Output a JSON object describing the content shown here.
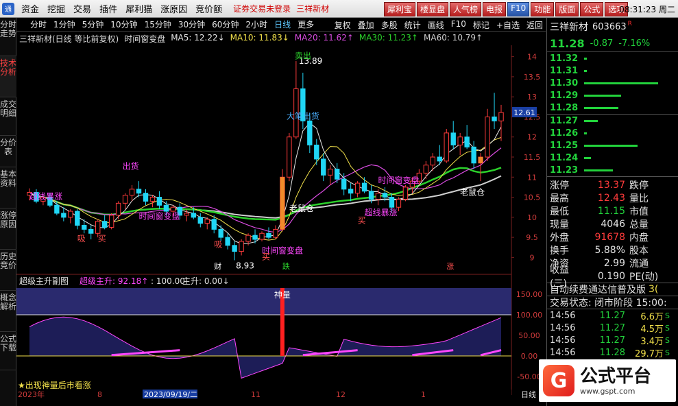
{
  "menubar": {
    "items": [
      "资金",
      "挖掘",
      "交易",
      "插件",
      "犀利猫",
      "涨原因",
      "竞价额"
    ],
    "notice": "证券交易未登录",
    "notice_stock": "三祥新材",
    "tool_buttons": [
      "犀利宝",
      "楼显盘",
      "人气榜",
      "电报",
      "F10",
      "功能",
      "版面",
      "公式",
      "选项"
    ],
    "clock": "08:31:23 周二"
  },
  "left_tabs": [
    "分时走势",
    "技术分析",
    "成交明细",
    "分价表",
    "基本资料",
    "涨停原因",
    "历史竞价",
    "概念解析",
    "公式下载"
  ],
  "active_left_tab": 1,
  "periods": [
    "分时",
    "1分钟",
    "5分钟",
    "10分钟",
    "15分钟",
    "30分钟",
    "60分钟",
    "2小时",
    "日线"
  ],
  "active_period": 8,
  "more_label": "更多",
  "right_tools": [
    "复权",
    "叠加",
    "多股",
    "统计",
    "画线",
    "F10",
    "标记",
    "+自选",
    "返回"
  ],
  "chart_header": {
    "title": "三祥新材(日线 等比前复权)",
    "indicator": "时间窗变盘",
    "ma5": "MA5: 12.22↓",
    "ma10": "MA10: 11.83↓",
    "ma20": "MA20: 11.62↑",
    "ma30": "MA30: 11.23↑",
    "ma60": "MA60: 10.79↑"
  },
  "colors": {
    "up": "#ff3b3b",
    "down": "#20d6f5",
    "ma5": "#e8e8e8",
    "ma10": "#f2e14b",
    "ma20": "#d94ce0",
    "ma30": "#2bd12b",
    "ma60": "#cfcfcf",
    "signal_magenta": "#ff47ff",
    "sub_area": "#2a2a6e"
  },
  "chart_data": {
    "type": "candlestick",
    "yaxis_ticks": [
      9.0,
      9.5,
      10.0,
      10.5,
      11.0,
      11.5,
      12.0,
      12.5,
      13.0,
      13.5,
      14.0
    ],
    "ylim": [
      8.75,
      14.25
    ],
    "current_price_marker": "12.61",
    "annotations": {
      "high_label": "13.89",
      "low_label": "8.93",
      "sell_signal_1": "出货",
      "sell_signal_2": "卖出",
      "big_sell": "大笔出货",
      "time_window": "时间窗变盘",
      "breakout": "超线暴涨",
      "rat_warehouse": "老鼠仓",
      "buy": "买",
      "buy_alt": "吸",
      "rise_mark": "涨",
      "fall_mark": "跌",
      "fin_mark": "财"
    },
    "candles": [
      [
        10.55,
        10.72,
        10.42,
        10.62
      ],
      [
        10.62,
        10.7,
        10.35,
        10.4
      ],
      [
        10.4,
        10.55,
        10.3,
        10.5
      ],
      [
        10.5,
        10.6,
        10.25,
        10.3
      ],
      [
        10.3,
        10.4,
        10.05,
        10.1
      ],
      [
        10.1,
        10.25,
        9.9,
        10.0
      ],
      [
        10.0,
        10.2,
        9.85,
        10.15
      ],
      [
        10.15,
        10.2,
        9.7,
        9.8
      ],
      [
        9.8,
        9.95,
        9.6,
        9.7
      ],
      [
        9.7,
        9.8,
        9.45,
        9.6
      ],
      [
        9.6,
        9.95,
        9.5,
        9.9
      ],
      [
        9.9,
        10.05,
        9.7,
        9.75
      ],
      [
        9.75,
        10.1,
        9.7,
        10.05
      ],
      [
        10.05,
        10.4,
        9.95,
        10.35
      ],
      [
        10.35,
        10.6,
        10.2,
        10.55
      ],
      [
        10.55,
        10.8,
        10.4,
        10.7
      ],
      [
        10.7,
        10.9,
        10.5,
        10.6
      ],
      [
        10.6,
        10.7,
        10.3,
        10.4
      ],
      [
        10.4,
        10.55,
        10.25,
        10.5
      ],
      [
        10.5,
        10.65,
        10.2,
        10.3
      ],
      [
        10.3,
        10.4,
        10.05,
        10.15
      ],
      [
        10.15,
        10.3,
        10.0,
        10.25
      ],
      [
        10.25,
        10.35,
        9.95,
        10.05
      ],
      [
        10.05,
        10.2,
        9.9,
        10.1
      ],
      [
        10.1,
        10.25,
        9.95,
        10.0
      ],
      [
        10.0,
        10.1,
        9.75,
        9.85
      ],
      [
        9.85,
        10.0,
        9.7,
        9.95
      ],
      [
        9.95,
        10.05,
        9.6,
        9.7
      ],
      [
        9.7,
        9.8,
        9.4,
        9.5
      ],
      [
        9.5,
        9.6,
        9.2,
        9.3
      ],
      [
        9.3,
        9.4,
        8.93,
        9.15
      ],
      [
        9.15,
        9.45,
        9.05,
        9.4
      ],
      [
        9.4,
        9.6,
        9.3,
        9.55
      ],
      [
        9.55,
        9.7,
        9.35,
        9.45
      ],
      [
        9.45,
        9.65,
        9.4,
        9.6
      ],
      [
        9.6,
        9.75,
        9.45,
        9.5
      ],
      [
        9.5,
        9.8,
        9.45,
        9.7
      ],
      [
        9.7,
        11.2,
        9.65,
        11.0
      ],
      [
        11.0,
        12.1,
        10.9,
        12.0
      ],
      [
        12.0,
        13.89,
        11.95,
        13.2
      ],
      [
        13.2,
        13.6,
        12.2,
        12.4
      ],
      [
        12.4,
        12.6,
        11.6,
        11.8
      ],
      [
        11.8,
        11.95,
        11.3,
        11.45
      ],
      [
        11.45,
        11.6,
        10.9,
        11.05
      ],
      [
        11.05,
        11.3,
        10.8,
        11.2
      ],
      [
        11.2,
        11.35,
        10.85,
        10.95
      ],
      [
        10.95,
        11.1,
        10.55,
        10.7
      ],
      [
        10.7,
        10.85,
        10.4,
        10.6
      ],
      [
        10.6,
        10.9,
        10.5,
        10.85
      ],
      [
        10.85,
        11.0,
        10.6,
        10.65
      ],
      [
        10.65,
        10.8,
        10.35,
        10.45
      ],
      [
        10.45,
        10.7,
        10.3,
        10.6
      ],
      [
        10.6,
        10.75,
        10.4,
        10.5
      ],
      [
        10.5,
        10.6,
        10.1,
        10.25
      ],
      [
        10.25,
        10.5,
        10.15,
        10.45
      ],
      [
        10.45,
        10.8,
        10.4,
        10.75
      ],
      [
        10.75,
        11.0,
        10.6,
        10.9
      ],
      [
        10.9,
        11.2,
        10.8,
        11.1
      ],
      [
        11.1,
        11.4,
        10.95,
        11.3
      ],
      [
        11.3,
        11.6,
        11.15,
        11.5
      ],
      [
        11.5,
        11.8,
        11.3,
        11.4
      ],
      [
        11.4,
        12.2,
        11.35,
        12.1
      ],
      [
        12.1,
        12.4,
        11.7,
        11.8
      ],
      [
        11.8,
        12.1,
        11.55,
        12.0
      ],
      [
        12.0,
        12.3,
        11.7,
        11.75
      ],
      [
        11.75,
        11.9,
        11.2,
        11.35
      ],
      [
        11.35,
        11.6,
        10.9,
        11.5
      ],
      [
        11.5,
        12.7,
        11.4,
        12.5
      ],
      [
        12.5,
        13.1,
        12.2,
        12.4
      ],
      [
        12.4,
        12.8,
        11.9,
        12.61
      ]
    ]
  },
  "sub_chart": {
    "title": "超级主升副图",
    "value1": "超级主升: 92.18↑",
    "value2": ": 100.00",
    "value3": "主升: 0.00↓",
    "yaxis_ticks": [
      "150.00",
      "100.00",
      "50.00",
      "0.00",
      "-50.00"
    ],
    "god_label": "神量",
    "footer_label": "★出现神量后市看涨",
    "dates": [
      "2023年",
      "8",
      "2023/09/19/二",
      "11",
      "12",
      "1"
    ],
    "right_label": "日线"
  },
  "right_panel": {
    "name": "三祥新材",
    "code": "603663",
    "code_flag": "R",
    "price": "11.28",
    "change": "-0.87",
    "change_pct": "-7.16%",
    "order_book_upper": [
      {
        "price": "11.32",
        "bar": 4
      },
      {
        "price": "11.31",
        "bar": 4
      },
      {
        "price": "11.30",
        "bar": 108
      },
      {
        "price": "11.29",
        "bar": 54
      },
      {
        "price": "11.28",
        "bar": 50
      }
    ],
    "order_book_lower": [
      {
        "price": "11.27",
        "bar": 20
      },
      {
        "price": "11.26",
        "bar": 4
      },
      {
        "price": "11.25",
        "bar": 78
      },
      {
        "price": "11.24",
        "bar": 10
      },
      {
        "price": "11.23",
        "bar": 42
      }
    ],
    "stats": [
      {
        "l1": "涨停",
        "v1": "13.37",
        "c1": "red",
        "l2": "跌停"
      },
      {
        "l1": "最高",
        "v1": "12.43",
        "c1": "red",
        "l2": "量比"
      },
      {
        "l1": "最低",
        "v1": "11.15",
        "c1": "green",
        "l2": "市值"
      },
      {
        "l1": "现量",
        "v1": "4046",
        "c1": "white",
        "l2": "总量"
      },
      {
        "l1": "外盘",
        "v1": "91678",
        "c1": "red",
        "l2": "内盘"
      },
      {
        "l1": "换手",
        "v1": "5.88%",
        "c1": "white",
        "l2": "股本"
      },
      {
        "l1": "净资",
        "v1": "2.99",
        "c1": "white",
        "l2": "流通"
      },
      {
        "l1": "收益(三)",
        "v1": "0.190",
        "c1": "white",
        "l2": "PE(动)"
      }
    ],
    "ticker_text": "自动续费通达信普及版",
    "ticker_tail": "3(",
    "trade_status": "交易状态: 闭市阶段 15:00:",
    "trades": [
      {
        "t": "14:56",
        "p": "11.27",
        "v": "6.6万",
        "s": "S"
      },
      {
        "t": "14:56",
        "p": "11.27",
        "v": "4.5万",
        "s": "S"
      },
      {
        "t": "14:56",
        "p": "11.27",
        "v": "3.4万",
        "s": "S"
      },
      {
        "t": "14:56",
        "p": "11.28",
        "v": "29.7万",
        "s": "S"
      }
    ]
  },
  "brand": {
    "icon_letter": "G",
    "title": "公式平台",
    "url": "www.gspt.com"
  }
}
